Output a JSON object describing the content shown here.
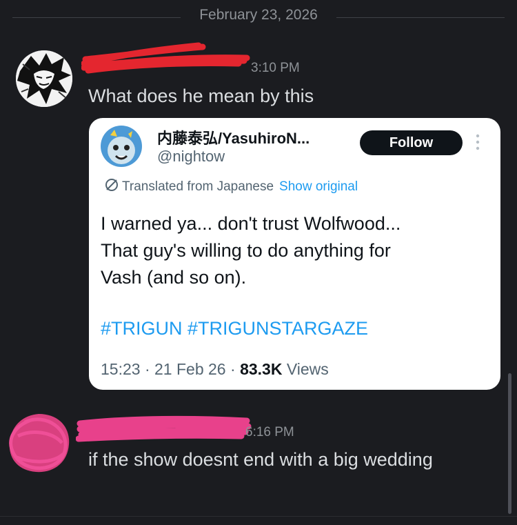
{
  "divider": {
    "date": "February 23, 2026"
  },
  "messages": [
    {
      "timestamp": "3:10 PM",
      "text": "What does he mean by this"
    },
    {
      "timestamp": "6:16 PM",
      "text": "if the show doesnt end with a big wedding"
    }
  ],
  "embed": {
    "display_name": "内藤泰弘/YasuhiroN...",
    "handle": "@nightow",
    "follow_label": "Follow",
    "translated_label": "Translated from Japanese",
    "show_original_label": "Show original",
    "body_lines": [
      "I warned ya... don't trust Wolfwood...",
      "That guy's willing to do anything for",
      "Vash (and so on)."
    ],
    "hashtags": [
      "#TRIGUN",
      "#TRIGUNSTARGAZE"
    ],
    "time": "15:23",
    "date": "21 Feb 26",
    "views_count": "83.3K",
    "views_label": "Views"
  },
  "colors": {
    "background": "#1b1c20",
    "redaction_red": "#e4262f",
    "redaction_pink": "#e8418b",
    "link_blue": "#1d9bf0"
  }
}
